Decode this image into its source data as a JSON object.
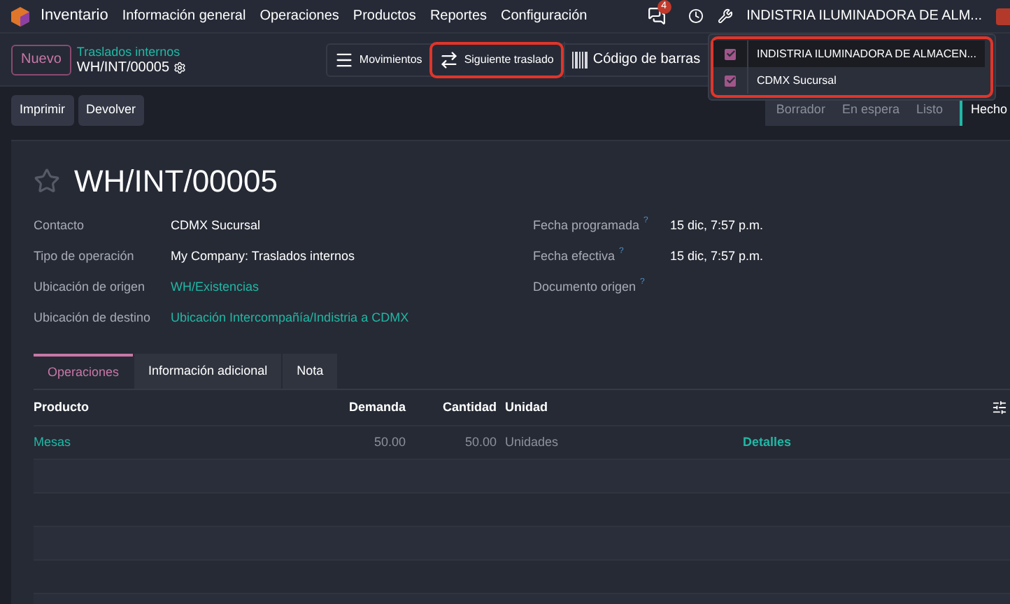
{
  "navbar": {
    "app": "Inventario",
    "menu": [
      "Información general",
      "Operaciones",
      "Productos",
      "Reportes",
      "Configuración"
    ],
    "message_count": "4",
    "company": "INDISTRIA ILUMINADORA DE ALM..."
  },
  "control_panel": {
    "new_button": "Nuevo",
    "breadcrumb": "Traslados internos",
    "record": "WH/INT/00005",
    "smart_buttons": [
      {
        "label": "Movimientos",
        "kind": "list",
        "highlighted": false
      },
      {
        "label": "Siguiente traslado",
        "kind": "transfer",
        "highlighted": true
      },
      {
        "label": "Código de barras",
        "kind": "barcode",
        "highlighted": false
      }
    ]
  },
  "company_menu": {
    "highlighted": true,
    "items": [
      {
        "label": "INDISTRIA ILUMINADORA DE ALMACEN...",
        "checked": true,
        "selected": true
      },
      {
        "label": "CDMX Sucursal",
        "checked": true,
        "selected": false
      }
    ]
  },
  "actions": [
    "Imprimir",
    "Devolver"
  ],
  "status_bar": [
    {
      "label": "Borrador",
      "selected": false
    },
    {
      "label": "En espera",
      "selected": false
    },
    {
      "label": "Listo",
      "selected": false
    },
    {
      "label": "Hecho",
      "selected": true
    }
  ],
  "form": {
    "title": "WH/INT/00005",
    "starred": false,
    "left_fields": [
      {
        "label": "Contacto",
        "value": "CDMX Sucursal",
        "link": false
      },
      {
        "label": "Tipo de operación",
        "value": "My Company: Traslados internos",
        "link": false
      },
      {
        "label": "Ubicación de origen",
        "value": "WH/Existencias",
        "link": true
      },
      {
        "label": "Ubicación de destino",
        "value": "Ubicación Intercompañía/Indistria a CDMX",
        "link": true
      }
    ],
    "right_fields": [
      {
        "label": "Fecha programada",
        "help": "?",
        "value": "15 dic, 7:57 p.m."
      },
      {
        "label": "Fecha efectiva",
        "help": "?",
        "value": "15 dic, 7:57 p.m."
      },
      {
        "label": "Documento origen",
        "help": "?"
      }
    ]
  },
  "tabs": [
    {
      "label": "Operaciones",
      "selected": true
    },
    {
      "label": "Información adicional",
      "selected": false
    },
    {
      "label": "Nota",
      "selected": false
    }
  ],
  "table": {
    "columns": [
      "Producto",
      "Demanda",
      "Cantidad",
      "Unidad"
    ],
    "rows": [
      {
        "product": "Mesas",
        "demand": "50.00",
        "quantity": "50.00",
        "unit": "Unidades",
        "details": "Detalles"
      }
    ]
  }
}
